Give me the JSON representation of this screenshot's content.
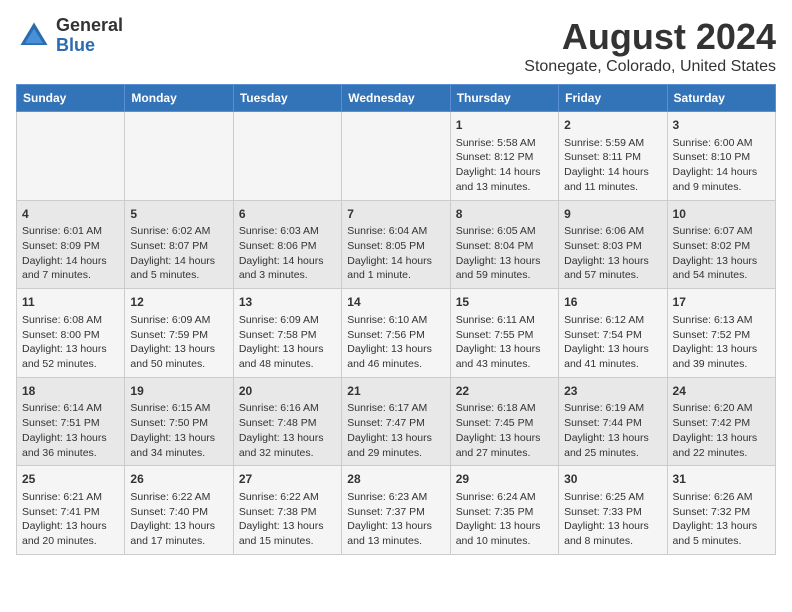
{
  "logo": {
    "general": "General",
    "blue": "Blue"
  },
  "title": "August 2024",
  "subtitle": "Stonegate, Colorado, United States",
  "days_of_week": [
    "Sunday",
    "Monday",
    "Tuesday",
    "Wednesday",
    "Thursday",
    "Friday",
    "Saturday"
  ],
  "weeks": [
    [
      {
        "day": "",
        "lines": []
      },
      {
        "day": "",
        "lines": []
      },
      {
        "day": "",
        "lines": []
      },
      {
        "day": "",
        "lines": []
      },
      {
        "day": "1",
        "lines": [
          "Sunrise: 5:58 AM",
          "Sunset: 8:12 PM",
          "Daylight: 14 hours",
          "and 13 minutes."
        ]
      },
      {
        "day": "2",
        "lines": [
          "Sunrise: 5:59 AM",
          "Sunset: 8:11 PM",
          "Daylight: 14 hours",
          "and 11 minutes."
        ]
      },
      {
        "day": "3",
        "lines": [
          "Sunrise: 6:00 AM",
          "Sunset: 8:10 PM",
          "Daylight: 14 hours",
          "and 9 minutes."
        ]
      }
    ],
    [
      {
        "day": "4",
        "lines": [
          "Sunrise: 6:01 AM",
          "Sunset: 8:09 PM",
          "Daylight: 14 hours",
          "and 7 minutes."
        ]
      },
      {
        "day": "5",
        "lines": [
          "Sunrise: 6:02 AM",
          "Sunset: 8:07 PM",
          "Daylight: 14 hours",
          "and 5 minutes."
        ]
      },
      {
        "day": "6",
        "lines": [
          "Sunrise: 6:03 AM",
          "Sunset: 8:06 PM",
          "Daylight: 14 hours",
          "and 3 minutes."
        ]
      },
      {
        "day": "7",
        "lines": [
          "Sunrise: 6:04 AM",
          "Sunset: 8:05 PM",
          "Daylight: 14 hours",
          "and 1 minute."
        ]
      },
      {
        "day": "8",
        "lines": [
          "Sunrise: 6:05 AM",
          "Sunset: 8:04 PM",
          "Daylight: 13 hours",
          "and 59 minutes."
        ]
      },
      {
        "day": "9",
        "lines": [
          "Sunrise: 6:06 AM",
          "Sunset: 8:03 PM",
          "Daylight: 13 hours",
          "and 57 minutes."
        ]
      },
      {
        "day": "10",
        "lines": [
          "Sunrise: 6:07 AM",
          "Sunset: 8:02 PM",
          "Daylight: 13 hours",
          "and 54 minutes."
        ]
      }
    ],
    [
      {
        "day": "11",
        "lines": [
          "Sunrise: 6:08 AM",
          "Sunset: 8:00 PM",
          "Daylight: 13 hours",
          "and 52 minutes."
        ]
      },
      {
        "day": "12",
        "lines": [
          "Sunrise: 6:09 AM",
          "Sunset: 7:59 PM",
          "Daylight: 13 hours",
          "and 50 minutes."
        ]
      },
      {
        "day": "13",
        "lines": [
          "Sunrise: 6:09 AM",
          "Sunset: 7:58 PM",
          "Daylight: 13 hours",
          "and 48 minutes."
        ]
      },
      {
        "day": "14",
        "lines": [
          "Sunrise: 6:10 AM",
          "Sunset: 7:56 PM",
          "Daylight: 13 hours",
          "and 46 minutes."
        ]
      },
      {
        "day": "15",
        "lines": [
          "Sunrise: 6:11 AM",
          "Sunset: 7:55 PM",
          "Daylight: 13 hours",
          "and 43 minutes."
        ]
      },
      {
        "day": "16",
        "lines": [
          "Sunrise: 6:12 AM",
          "Sunset: 7:54 PM",
          "Daylight: 13 hours",
          "and 41 minutes."
        ]
      },
      {
        "day": "17",
        "lines": [
          "Sunrise: 6:13 AM",
          "Sunset: 7:52 PM",
          "Daylight: 13 hours",
          "and 39 minutes."
        ]
      }
    ],
    [
      {
        "day": "18",
        "lines": [
          "Sunrise: 6:14 AM",
          "Sunset: 7:51 PM",
          "Daylight: 13 hours",
          "and 36 minutes."
        ]
      },
      {
        "day": "19",
        "lines": [
          "Sunrise: 6:15 AM",
          "Sunset: 7:50 PM",
          "Daylight: 13 hours",
          "and 34 minutes."
        ]
      },
      {
        "day": "20",
        "lines": [
          "Sunrise: 6:16 AM",
          "Sunset: 7:48 PM",
          "Daylight: 13 hours",
          "and 32 minutes."
        ]
      },
      {
        "day": "21",
        "lines": [
          "Sunrise: 6:17 AM",
          "Sunset: 7:47 PM",
          "Daylight: 13 hours",
          "and 29 minutes."
        ]
      },
      {
        "day": "22",
        "lines": [
          "Sunrise: 6:18 AM",
          "Sunset: 7:45 PM",
          "Daylight: 13 hours",
          "and 27 minutes."
        ]
      },
      {
        "day": "23",
        "lines": [
          "Sunrise: 6:19 AM",
          "Sunset: 7:44 PM",
          "Daylight: 13 hours",
          "and 25 minutes."
        ]
      },
      {
        "day": "24",
        "lines": [
          "Sunrise: 6:20 AM",
          "Sunset: 7:42 PM",
          "Daylight: 13 hours",
          "and 22 minutes."
        ]
      }
    ],
    [
      {
        "day": "25",
        "lines": [
          "Sunrise: 6:21 AM",
          "Sunset: 7:41 PM",
          "Daylight: 13 hours",
          "and 20 minutes."
        ]
      },
      {
        "day": "26",
        "lines": [
          "Sunrise: 6:22 AM",
          "Sunset: 7:40 PM",
          "Daylight: 13 hours",
          "and 17 minutes."
        ]
      },
      {
        "day": "27",
        "lines": [
          "Sunrise: 6:22 AM",
          "Sunset: 7:38 PM",
          "Daylight: 13 hours",
          "and 15 minutes."
        ]
      },
      {
        "day": "28",
        "lines": [
          "Sunrise: 6:23 AM",
          "Sunset: 7:37 PM",
          "Daylight: 13 hours",
          "and 13 minutes."
        ]
      },
      {
        "day": "29",
        "lines": [
          "Sunrise: 6:24 AM",
          "Sunset: 7:35 PM",
          "Daylight: 13 hours",
          "and 10 minutes."
        ]
      },
      {
        "day": "30",
        "lines": [
          "Sunrise: 6:25 AM",
          "Sunset: 7:33 PM",
          "Daylight: 13 hours",
          "and 8 minutes."
        ]
      },
      {
        "day": "31",
        "lines": [
          "Sunrise: 6:26 AM",
          "Sunset: 7:32 PM",
          "Daylight: 13 hours",
          "and 5 minutes."
        ]
      }
    ]
  ],
  "colors": {
    "header_bg": "#3373b8",
    "odd_row": "#f5f5f5",
    "even_row": "#e8e8e8"
  }
}
